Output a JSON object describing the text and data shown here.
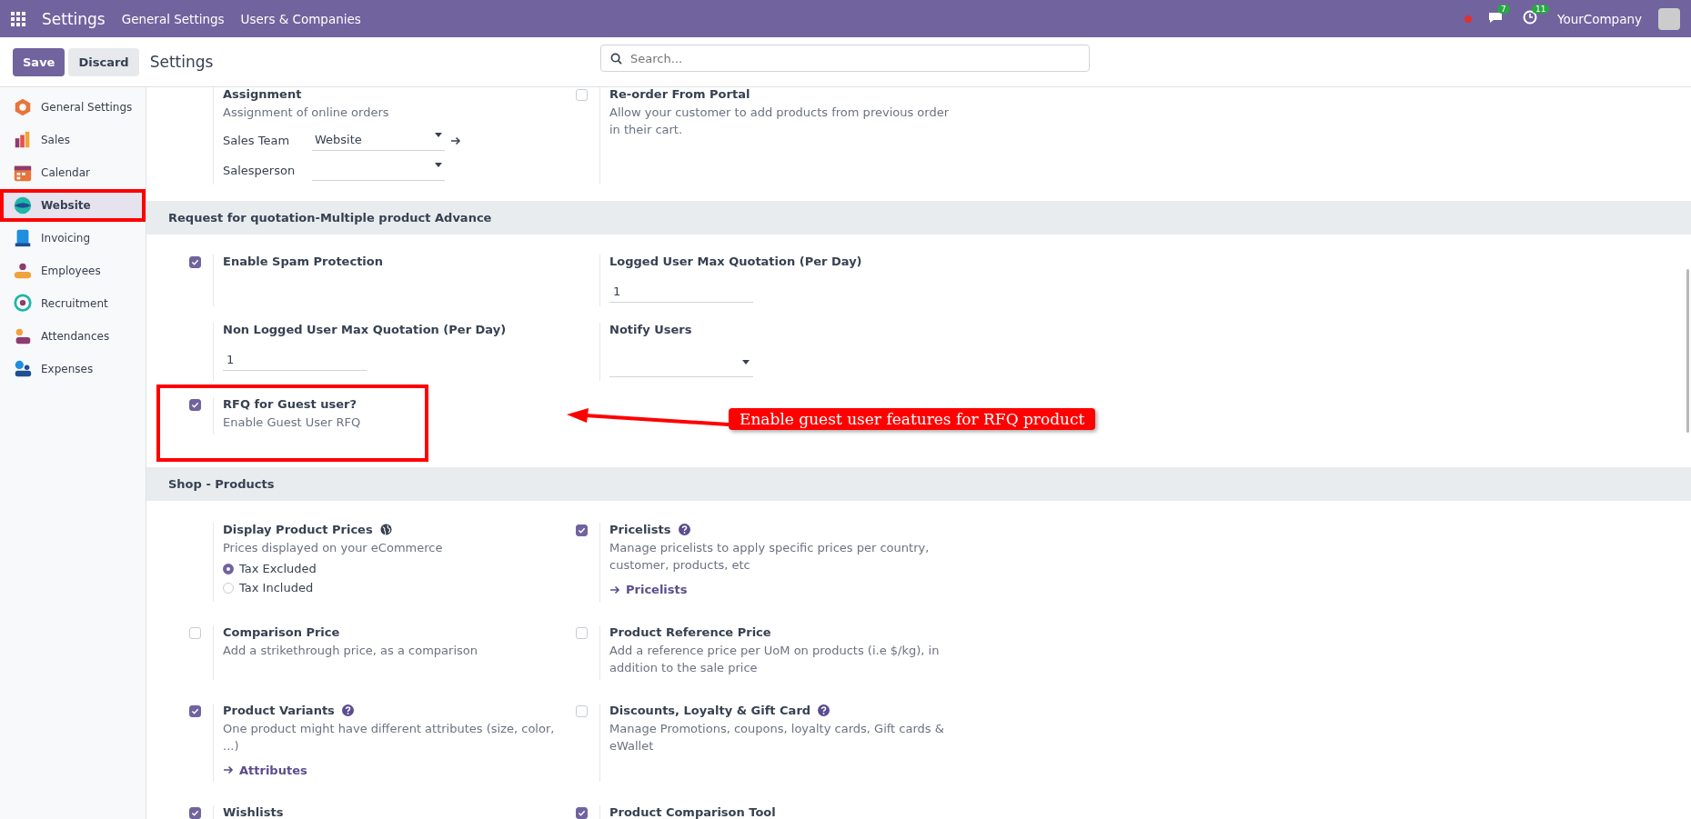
{
  "navbar": {
    "app_title": "Settings",
    "menu": [
      "General Settings",
      "Users & Companies"
    ],
    "messages_count": "7",
    "activities_count": "11",
    "company": "YourCompany"
  },
  "control_panel": {
    "save": "Save",
    "discard": "Discard",
    "breadcrumb": "Settings",
    "search": {
      "placeholder": "Search..."
    }
  },
  "sidebar": {
    "items": [
      {
        "label": "General Settings",
        "selected": false,
        "highlighted": false
      },
      {
        "label": "Sales",
        "selected": false,
        "highlighted": false
      },
      {
        "label": "Calendar",
        "selected": false,
        "highlighted": false
      },
      {
        "label": "Website",
        "selected": true,
        "highlighted": true
      },
      {
        "label": "Invoicing",
        "selected": false,
        "highlighted": false
      },
      {
        "label": "Employees",
        "selected": false,
        "highlighted": false
      },
      {
        "label": "Recruitment",
        "selected": false,
        "highlighted": false
      },
      {
        "label": "Attendances",
        "selected": false,
        "highlighted": false
      },
      {
        "label": "Expenses",
        "selected": false,
        "highlighted": false
      }
    ]
  },
  "top_settings": [
    {
      "kind": "fields",
      "title": "Assignment",
      "description": "Assignment of online orders",
      "fields": [
        {
          "label": "Sales Team",
          "value": "Website",
          "link": true
        },
        {
          "label": "Salesperson",
          "link": false
        }
      ]
    },
    {
      "kind": "checkbox",
      "checked": false,
      "title": "Re-order From Portal",
      "description": "Allow your customer to add products from previous order in their cart."
    }
  ],
  "sections": [
    {
      "title": "Request for quotation-Multiple product Advance",
      "settings": [
        {
          "kind": "checkbox",
          "checked": true,
          "title": "Enable Spam Protection"
        },
        {
          "kind": "input",
          "title": "Logged User Max Quotation (Per Day)",
          "value": "1"
        },
        {
          "kind": "input",
          "title": "Non Logged User Max Quotation (Per Day)",
          "value": "1"
        },
        {
          "kind": "select",
          "title": "Notify Users"
        },
        {
          "kind": "checkbox",
          "checked": true,
          "title": "RFQ for Guest user?",
          "description": "Enable Guest User RFQ",
          "highlighted": true,
          "callout": "Enable guest user features for RFQ product"
        }
      ]
    },
    {
      "title": "Shop - Products",
      "settings": [
        {
          "kind": "radio",
          "title": "Display Product Prices",
          "global": true,
          "description": "Prices displayed on your eCommerce",
          "options": [
            {
              "label": "Tax Excluded",
              "selected": true
            },
            {
              "label": "Tax Included",
              "selected": false
            }
          ]
        },
        {
          "kind": "checkbox",
          "checked": true,
          "title": "Pricelists",
          "help": true,
          "description": "Manage pricelists to apply specific prices per country, customer, products, etc",
          "link": "Pricelists"
        },
        {
          "kind": "checkbox",
          "checked": false,
          "title": "Comparison Price",
          "description": "Add a strikethrough price, as a comparison"
        },
        {
          "kind": "checkbox",
          "checked": false,
          "title": "Product Reference Price",
          "description": "Add a reference price per UoM on products (i.e $/kg), in addition to the sale price"
        },
        {
          "kind": "checkbox",
          "checked": true,
          "title": "Product Variants",
          "help": true,
          "description": "One product might have different attributes (size, color, ...)",
          "link": "Attributes"
        },
        {
          "kind": "checkbox",
          "checked": false,
          "title": "Discounts, Loyalty & Gift Card",
          "help": true,
          "description": "Manage Promotions, coupons, loyalty cards, Gift cards & eWallet"
        },
        {
          "kind": "checkbox",
          "checked": true,
          "title": "Wishlists"
        },
        {
          "kind": "checkbox",
          "checked": true,
          "title": "Product Comparison Tool"
        }
      ]
    }
  ]
}
